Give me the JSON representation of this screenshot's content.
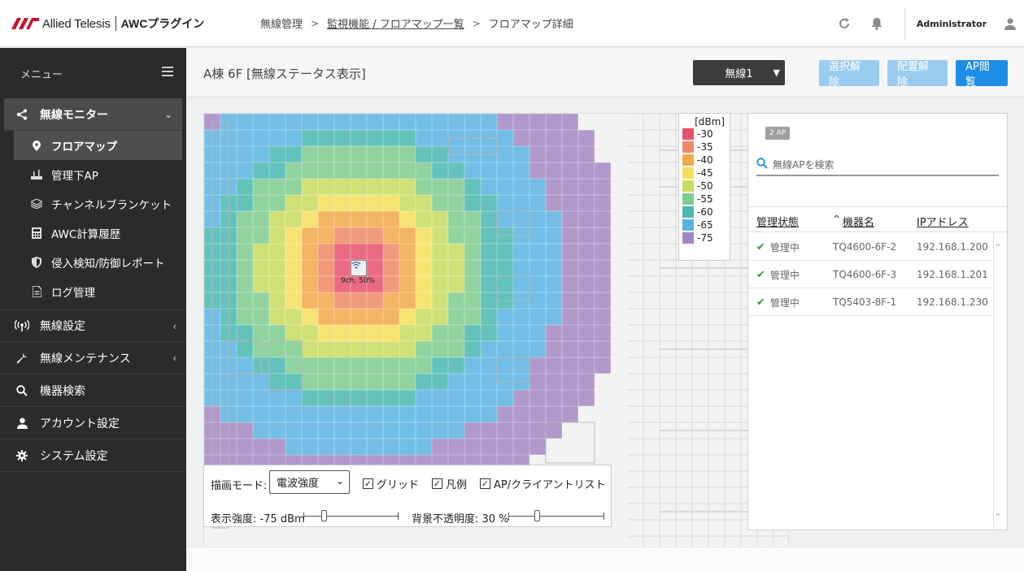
{
  "header": {
    "brand": "Allied Telesis",
    "product": "AWCプラグイン",
    "breadcrumb": [
      {
        "label": "無線管理",
        "link": false
      },
      {
        "label": "監視機能 / フロアマップ一覧",
        "link": true
      },
      {
        "label": "フロアマップ詳細",
        "link": false
      }
    ],
    "breadcrumb_sep": ">",
    "user": "Administrator",
    "icons": [
      "refresh-icon",
      "bell-icon",
      "user-icon"
    ]
  },
  "sidebar": {
    "menu_label": "メニュー",
    "items": [
      {
        "label": "無線モニター",
        "icon": "share-icon",
        "expanded": true,
        "active": true,
        "children": [
          {
            "label": "フロアマップ",
            "icon": "map-pin-icon",
            "active": true
          },
          {
            "label": "管理下AP",
            "icon": "ap-icon"
          },
          {
            "label": "チャンネルブランケット",
            "icon": "layers-icon"
          },
          {
            "label": "AWC計算履歴",
            "icon": "calculator-icon"
          },
          {
            "label": "侵入検知/防御レポート",
            "icon": "shield-icon"
          },
          {
            "label": "ログ管理",
            "icon": "document-icon"
          }
        ]
      },
      {
        "label": "無線設定",
        "icon": "antenna-icon",
        "collapsible": true
      },
      {
        "label": "無線メンテナンス",
        "icon": "wrench-icon",
        "collapsible": true
      },
      {
        "label": "機器検索",
        "icon": "search-icon"
      },
      {
        "label": "アカウント設定",
        "icon": "user-icon"
      },
      {
        "label": "システム設定",
        "icon": "gear-icon"
      }
    ]
  },
  "content": {
    "title": "A棟 6F [無線ステータス表示]",
    "radio_select": "無線1",
    "buttons": {
      "deselect": "選択解除",
      "unplace": "配置解除",
      "ap_view": "AP閲覧"
    }
  },
  "map": {
    "ap_label": "9ch, 50%"
  },
  "legend": {
    "unit": "[dBm]",
    "entries": [
      {
        "label": "-30",
        "color": "#e8516e"
      },
      {
        "label": "-35",
        "color": "#ef8a65"
      },
      {
        "label": "-40",
        "color": "#f2a94a"
      },
      {
        "label": "-45",
        "color": "#f7df5a"
      },
      {
        "label": "-50",
        "color": "#c9dc5f"
      },
      {
        "label": "-55",
        "color": "#7fcc8f"
      },
      {
        "label": "-60",
        "color": "#4ab8b3"
      },
      {
        "label": "-65",
        "color": "#5ab4e3"
      },
      {
        "label": "-75",
        "color": "#a488c4"
      }
    ]
  },
  "controls": {
    "draw_mode_label": "描画モード:",
    "draw_mode_value": "電波強度",
    "grid_label": "グリッド",
    "legend_label": "凡例",
    "aplist_label": "AP/クライアントリスト",
    "grid_checked": true,
    "legend_checked": true,
    "aplist_checked": true,
    "strength_label": "表示強度: -75 dBm",
    "opacity_label": "背景不透明度: 30 %",
    "strength_value": -75,
    "opacity_value": 30
  },
  "ap_panel": {
    "count_badge": "2 AP",
    "search_placeholder": "無線APを検索",
    "columns": {
      "status": "管理状態",
      "sort_indicator": "^",
      "name": "機器名",
      "ip": "IPアドレス"
    },
    "rows": [
      {
        "status": "管理中",
        "name": "TQ4600-6F-2",
        "ip": "192.168.1.200"
      },
      {
        "status": "管理中",
        "name": "TQ4600-6F-3",
        "ip": "192.168.1.201"
      },
      {
        "status": "管理中",
        "name": "TQ5403-8F-1",
        "ip": "192.168.1.230"
      }
    ]
  },
  "colors": {
    "accent": "#1e8de6",
    "sidebar_bg": "#2b2b2b",
    "status_ok": "#2e9a3e",
    "brand_red": "#c8102e"
  }
}
